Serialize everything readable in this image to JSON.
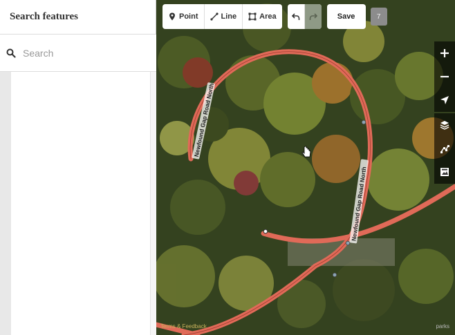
{
  "sidebar": {
    "title": "Search features",
    "search": {
      "placeholder": "Search",
      "value": ""
    }
  },
  "toolbar": {
    "point_label": "Point",
    "line_label": "Line",
    "area_label": "Area",
    "save_label": "Save",
    "edit_count": "7"
  },
  "map": {
    "road_label_1": "Newfound Gap Road North",
    "road_label_2": "Newfound Gap Road North",
    "road_color": "#e06a58",
    "attribution": "Terms & Feedback",
    "imagery_credit": "parks"
  },
  "map_controls": [
    "zoom-in-icon",
    "zoom-out-icon",
    "geolocate-icon",
    "layers-icon",
    "map-data-icon",
    "help-icon"
  ]
}
